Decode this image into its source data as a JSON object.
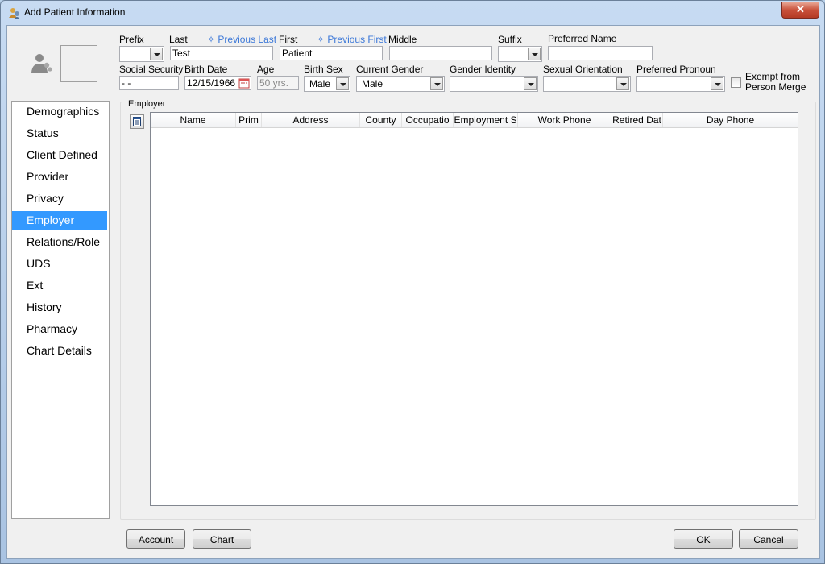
{
  "window": {
    "title": "Add Patient Information",
    "close_glyph": "✕"
  },
  "patient": {
    "prefix": {
      "label": "Prefix",
      "value": ""
    },
    "last": {
      "label": "Last",
      "value": "Test",
      "history_link": "✧ Previous Last"
    },
    "first": {
      "label": "First",
      "value": "Patient",
      "history_link": "✧ Previous First"
    },
    "middle": {
      "label": "Middle",
      "value": ""
    },
    "suffix": {
      "label": "Suffix",
      "value": ""
    },
    "preferred_name": {
      "label": "Preferred Name",
      "value": ""
    },
    "social_security": {
      "label": "Social Security",
      "value": " -  -"
    },
    "birth_date": {
      "label": "Birth Date",
      "value": "12/15/1966"
    },
    "age": {
      "label": "Age",
      "value": "50 yrs."
    },
    "birth_sex": {
      "label": "Birth Sex",
      "value": "Male"
    },
    "current_gender": {
      "label": "Current Gender",
      "value": "Male"
    },
    "gender_identity": {
      "label": "Gender Identity",
      "value": ""
    },
    "sexual_orientation": {
      "label": "Sexual Orientation",
      "value": ""
    },
    "preferred_pronoun": {
      "label": "Preferred Pronoun",
      "value": ""
    },
    "exempt_merge": {
      "label_line1": "Exempt from",
      "label_line2": "Person Merge",
      "checked": false
    }
  },
  "nav": {
    "items": [
      "Demographics",
      "Status",
      "Client Defined",
      "Provider",
      "Privacy",
      "Employer",
      "Relations/Role",
      "UDS",
      "Ext",
      "History",
      "Pharmacy",
      "Chart Details"
    ],
    "active": "Employer"
  },
  "employer": {
    "group_label": "Employer",
    "columns": [
      "Name",
      "Prim",
      "Address",
      "County",
      "Occupatio",
      "Employment S",
      "Work Phone",
      "Retired Dat",
      "Day Phone"
    ],
    "rows": []
  },
  "footer": {
    "account": "Account",
    "chart": "Chart",
    "ok": "OK",
    "cancel": "Cancel"
  },
  "colors": {
    "selection": "#3399ff",
    "link": "#3c78d8",
    "frame": "#b9d1ea"
  }
}
